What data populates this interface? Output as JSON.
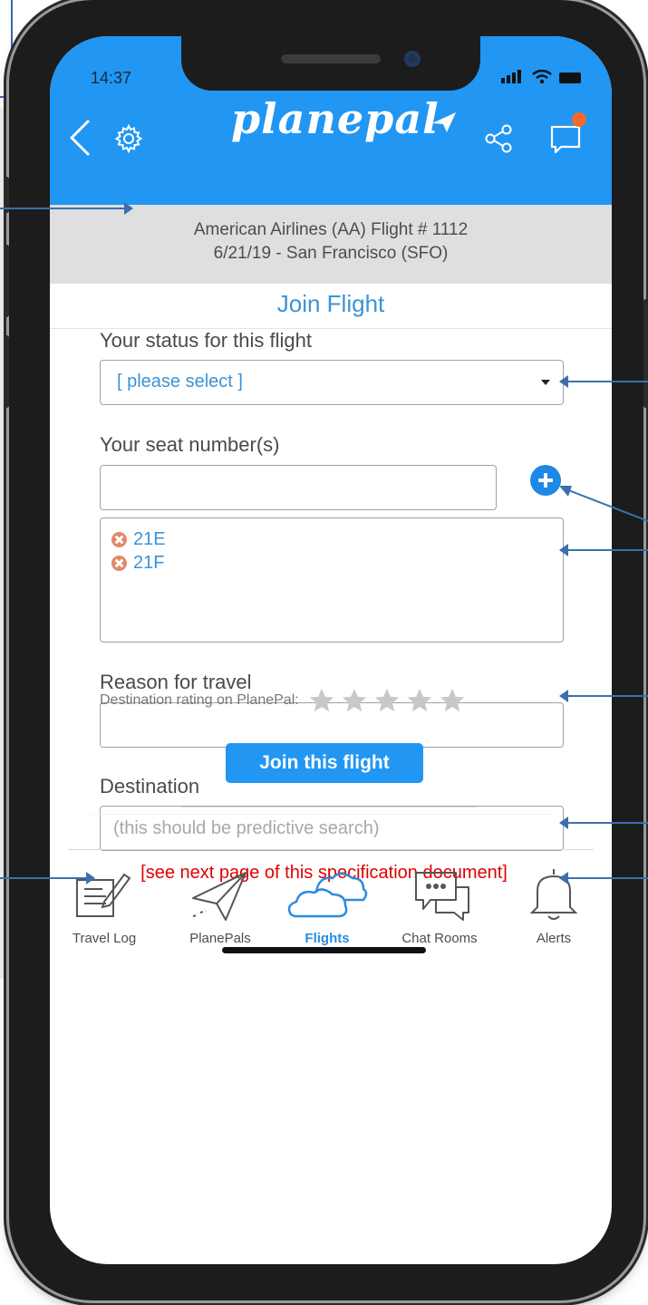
{
  "status_bar": {
    "time": "14:37"
  },
  "header": {
    "app_name": "planepal"
  },
  "flight": {
    "line1": "American Airlines (AA) Flight # 1112",
    "line2": "6/21/19 - San Francisco (SFO)"
  },
  "page_title": "Join Flight",
  "form": {
    "status_label": "Your status for this flight",
    "status_value": "[ please select ]",
    "seat_label": "Your seat number(s)",
    "seat_input_value": "",
    "seats": [
      "21E",
      "21F"
    ],
    "reason_label": "Reason for travel",
    "reason_value": "",
    "destination_label": "Destination",
    "destination_placeholder": "(this should be predictive search)",
    "rating_label": "Destination rating on PlanePal:",
    "rating_value": 0,
    "rating_max": 5,
    "submit_label": "Join this flight"
  },
  "note": "[see next page of this specification document]",
  "nav": {
    "items": [
      {
        "label": "Travel Log",
        "icon": "notepad-pencil-icon"
      },
      {
        "label": "PlanePals",
        "icon": "paper-plane-icon"
      },
      {
        "label": "Flights",
        "icon": "clouds-icon",
        "active": true
      },
      {
        "label": "Chat Rooms",
        "icon": "chat-bubbles-icon"
      },
      {
        "label": "Alerts",
        "icon": "bell-icon"
      }
    ]
  },
  "colors": {
    "brand": "#2196f3",
    "accent_text": "#3c93d6",
    "notification": "#f26b2c",
    "remove": "#e08a6a",
    "annotation_arrow": "#3d6fae",
    "note": "#e00000"
  }
}
